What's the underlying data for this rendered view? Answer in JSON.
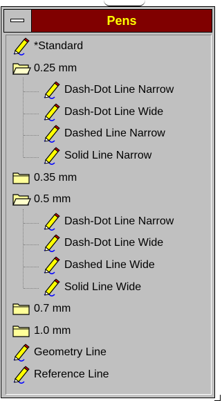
{
  "window": {
    "title": "Pens"
  },
  "tree": [
    {
      "type": "pen",
      "label": "*Standard",
      "level": 0
    },
    {
      "type": "folder-open",
      "label": "0.25 mm",
      "level": 0
    },
    {
      "type": "pen",
      "label": "Dash-Dot Line Narrow",
      "level": 1
    },
    {
      "type": "pen",
      "label": "Dash-Dot Line Wide",
      "level": 1
    },
    {
      "type": "pen",
      "label": "Dashed Line Narrow",
      "level": 1
    },
    {
      "type": "pen",
      "label": "Solid Line Narrow",
      "level": 1
    },
    {
      "type": "folder-closed",
      "label": "0.35 mm",
      "level": 0
    },
    {
      "type": "folder-open",
      "label": "0.5 mm",
      "level": 0
    },
    {
      "type": "pen",
      "label": "Dash-Dot Line Narrow",
      "level": 1
    },
    {
      "type": "pen",
      "label": "Dash-Dot Line Wide",
      "level": 1
    },
    {
      "type": "pen",
      "label": "Dashed Line Wide",
      "level": 1
    },
    {
      "type": "pen",
      "label": "Solid Line Wide",
      "level": 1
    },
    {
      "type": "folder-closed",
      "label": "0.7 mm",
      "level": 0
    },
    {
      "type": "folder-closed",
      "label": "1.0 mm",
      "level": 0
    },
    {
      "type": "pen",
      "label": "Geometry Line",
      "level": 0
    },
    {
      "type": "pen",
      "label": "Reference Line",
      "level": 0
    }
  ],
  "colors": {
    "titlebar": "#800000",
    "title_text": "#ffff00",
    "face": "#c0c0c0",
    "folder": "#ffff99"
  }
}
